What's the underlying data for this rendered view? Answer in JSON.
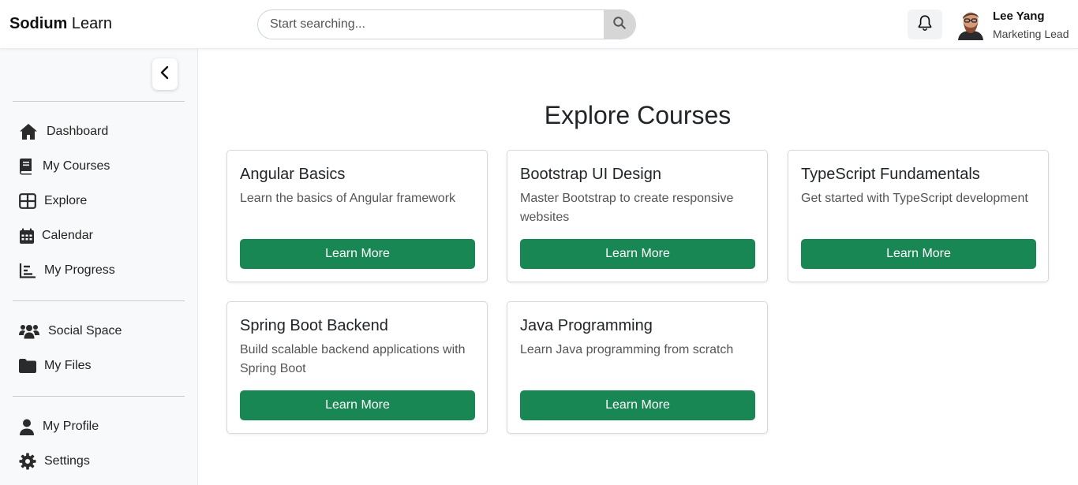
{
  "header": {
    "brand_bold": "Sodium",
    "brand_light": "Learn",
    "search_placeholder": "Start searching...",
    "user_name": "Lee Yang",
    "user_role": "Marketing Lead"
  },
  "sidebar": {
    "items": [
      {
        "label": "Dashboard",
        "icon": "home-icon"
      },
      {
        "label": "My Courses",
        "icon": "book-icon"
      },
      {
        "label": "Explore",
        "icon": "grid-icon"
      },
      {
        "label": "Calendar",
        "icon": "calendar-icon"
      },
      {
        "label": "My Progress",
        "icon": "chart-icon"
      },
      {
        "label": "Social Space",
        "icon": "users-icon"
      },
      {
        "label": "My Files",
        "icon": "folder-icon"
      },
      {
        "label": "My Profile",
        "icon": "user-icon"
      },
      {
        "label": "Settings",
        "icon": "gear-icon"
      }
    ]
  },
  "main": {
    "title": "Explore Courses",
    "courses": [
      {
        "title": "Angular Basics",
        "description": "Learn the basics of Angular framework",
        "button": "Learn More"
      },
      {
        "title": "Bootstrap UI Design",
        "description": "Master Bootstrap to create responsive websites",
        "button": "Learn More"
      },
      {
        "title": "TypeScript Fundamentals",
        "description": "Get started with TypeScript development",
        "button": "Learn More"
      },
      {
        "title": "Spring Boot Backend",
        "description": "Build scalable backend applications with Spring Boot",
        "button": "Learn More"
      },
      {
        "title": "Java Programming",
        "description": "Learn Java programming from scratch",
        "button": "Learn More"
      }
    ]
  },
  "colors": {
    "accent": "#198754",
    "sidebar_bg": "#f8f9fa",
    "icon": "#2b2b2b"
  }
}
